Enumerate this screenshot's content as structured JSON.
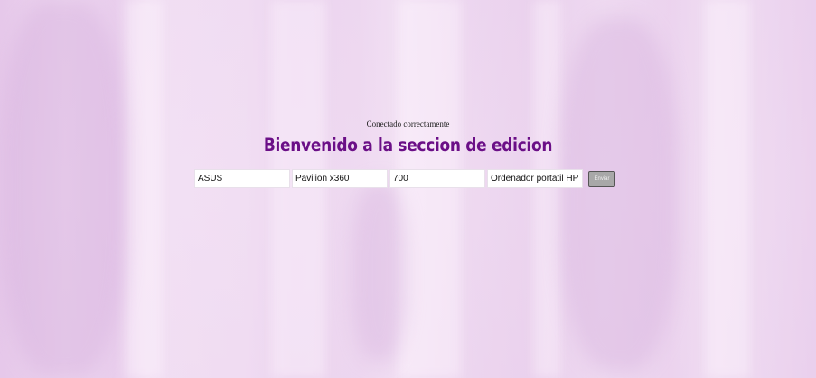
{
  "page": {
    "status_message": "Conectado correctamente",
    "title": "Bienvenido a la seccion de edicion"
  },
  "form": {
    "fields": [
      {
        "value": "ASUS"
      },
      {
        "value": "Pavilion x360"
      },
      {
        "value": "700"
      },
      {
        "value": "Ordenador portatil HP Pavilion"
      }
    ],
    "submit_label": "Enviar"
  },
  "colors": {
    "title": "#6b0f87",
    "background": "#ecd4ee",
    "button": "#a8a8a8"
  }
}
